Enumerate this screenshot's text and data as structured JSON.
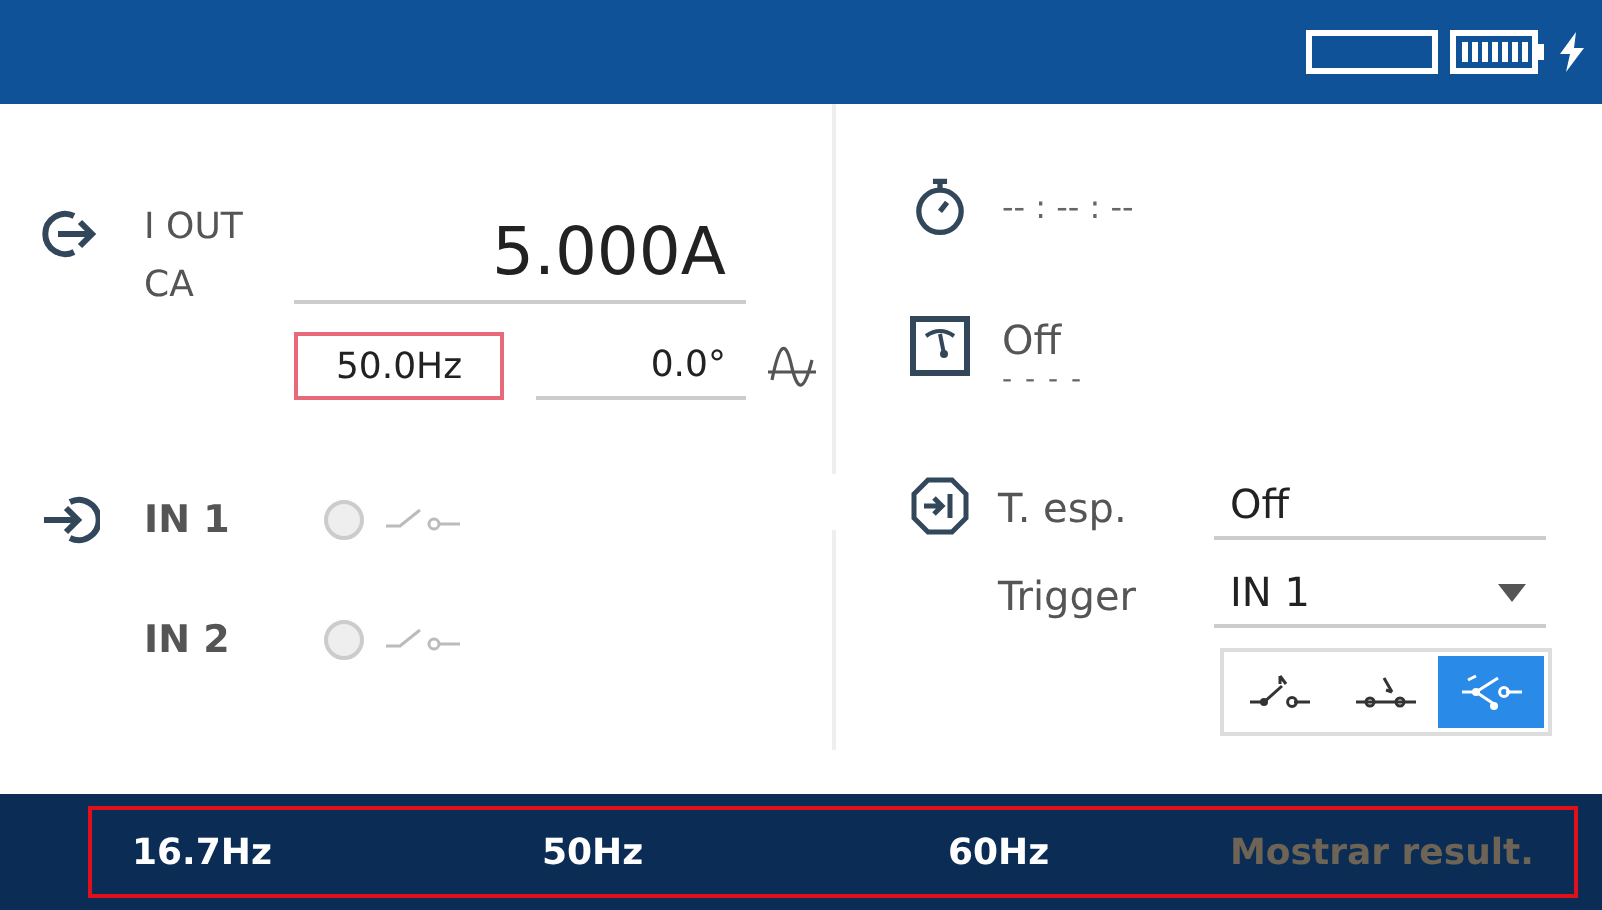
{
  "output": {
    "label_lines": [
      "I OUT",
      "CA"
    ],
    "amplitude": "5.000A",
    "frequency": {
      "value": "50.0Hz",
      "focused": true
    },
    "phase": {
      "value": "0.0°",
      "focused": false
    }
  },
  "inputs": [
    {
      "label": "IN 1",
      "active": false
    },
    {
      "label": "IN 2",
      "active": false
    }
  ],
  "timer": {
    "value": "-- : -- : --"
  },
  "meter": {
    "value": "Off",
    "reading": "- - - -"
  },
  "wait": {
    "label": "T. esp.",
    "value": "Off"
  },
  "trigger": {
    "label": "Trigger",
    "value": "IN 1"
  },
  "trigger_modes": [
    {
      "kind": "open",
      "selected": false
    },
    {
      "kind": "close",
      "selected": false
    },
    {
      "kind": "toggle",
      "selected": true
    }
  ],
  "softkeys": {
    "focused": true,
    "items": [
      {
        "label": "16.7Hz",
        "disabled": false
      },
      {
        "label": "50Hz",
        "disabled": false
      },
      {
        "label": "60Hz",
        "disabled": false
      },
      {
        "label": "Mostrar result.",
        "disabled": true
      }
    ]
  }
}
